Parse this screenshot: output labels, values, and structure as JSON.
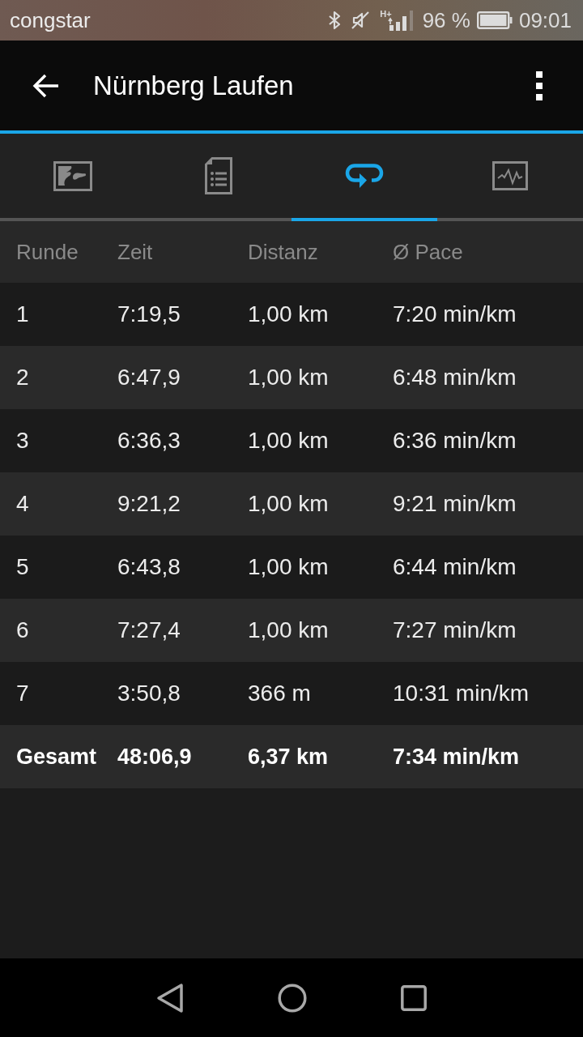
{
  "status_bar": {
    "carrier": "congstar",
    "network_type": "H+",
    "battery": "96 %",
    "time": "09:01"
  },
  "app_bar": {
    "title": "Nürnberg Laufen"
  },
  "tabs": [
    {
      "kind": "map",
      "selected": false
    },
    {
      "kind": "details",
      "selected": false
    },
    {
      "kind": "laps",
      "selected": true
    },
    {
      "kind": "chart",
      "selected": false
    }
  ],
  "table": {
    "columns": [
      "Runde",
      "Zeit",
      "Distanz",
      "Ø Pace"
    ],
    "rows": [
      [
        "1",
        "7:19,5",
        "1,00 km",
        "7:20 min/km"
      ],
      [
        "2",
        "6:47,9",
        "1,00 km",
        "6:48 min/km"
      ],
      [
        "3",
        "6:36,3",
        "1,00 km",
        "6:36 min/km"
      ],
      [
        "4",
        "9:21,2",
        "1,00 km",
        "9:21 min/km"
      ],
      [
        "5",
        "6:43,8",
        "1,00 km",
        "6:44 min/km"
      ],
      [
        "6",
        "7:27,4",
        "1,00 km",
        "7:27 min/km"
      ],
      [
        "7",
        "3:50,8",
        "366 m",
        "10:31 min/km"
      ]
    ],
    "total": [
      "Gesamt",
      "48:06,9",
      "6,37 km",
      "7:34 min/km"
    ]
  }
}
